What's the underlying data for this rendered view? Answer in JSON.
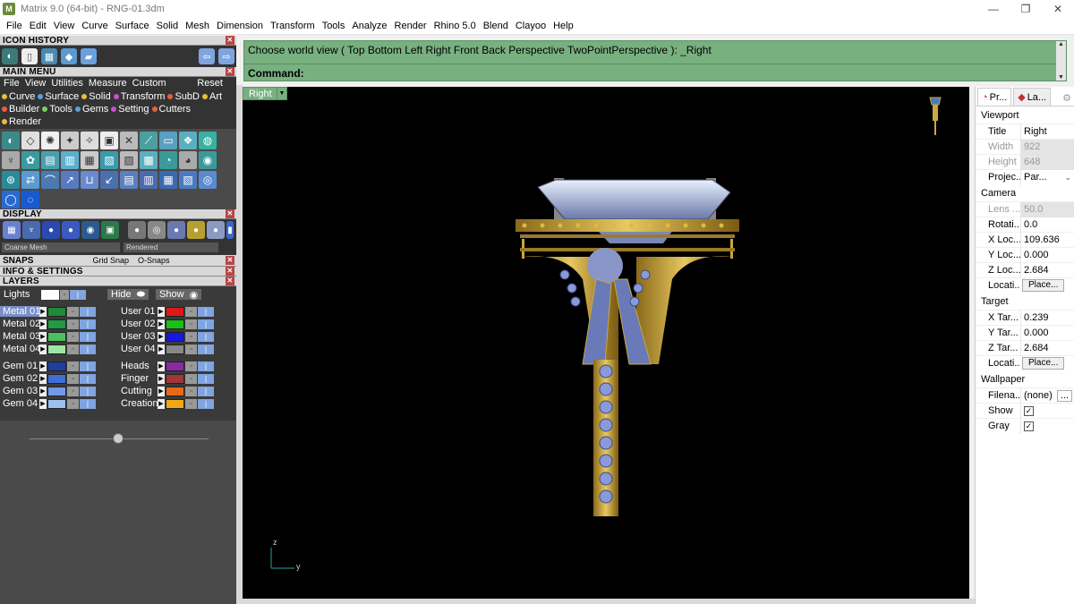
{
  "window": {
    "title": "Matrix 9.0 (64-bit) - RNG-01.3dm",
    "min": "—",
    "max": "❐",
    "close": "✕"
  },
  "menubar": [
    "File",
    "Edit",
    "View",
    "Curve",
    "Surface",
    "Solid",
    "Mesh",
    "Dimension",
    "Transform",
    "Tools",
    "Analyze",
    "Render",
    "Rhino 5.0",
    "Blend",
    "Clayoo",
    "Help"
  ],
  "panels": {
    "icon_history": "ICON HISTORY",
    "main_menu": "MAIN MENU",
    "display": "DISPLAY",
    "snaps": "SNAPS",
    "info": "INFO & SETTINGS",
    "layers": "LAYERS",
    "close": "✕"
  },
  "main_menu": {
    "items": [
      "File",
      "View",
      "Utilities",
      "Measure",
      "Custom"
    ],
    "reset": "Reset",
    "categories": [
      {
        "label": "Curve",
        "color": "#e8c038"
      },
      {
        "label": "Surface",
        "color": "#5aa0e0"
      },
      {
        "label": "Solid",
        "color": "#e8c038"
      },
      {
        "label": "Transform",
        "color": "#c84fd0"
      },
      {
        "label": "SubD",
        "color": "#e86040"
      },
      {
        "label": "Art",
        "color": "#e8c038"
      },
      {
        "label": "Builder",
        "color": "#e86040"
      },
      {
        "label": "Tools",
        "color": "#7ad060"
      },
      {
        "label": "Gems",
        "color": "#5aa0e0"
      },
      {
        "label": "Setting",
        "color": "#c84fd0"
      },
      {
        "label": "Cutters",
        "color": "#e86040"
      },
      {
        "label": "Render",
        "color": "#e8c038"
      }
    ]
  },
  "display": {
    "mesh": "Coarse Mesh",
    "mode": "Rendered"
  },
  "snaps": {
    "grid_snap": "Grid Snap",
    "osnaps": "O-Snaps"
  },
  "layers": {
    "lights": "Lights",
    "hide": "Hide",
    "show": "Show",
    "left": [
      {
        "name": "Metal 01",
        "color": "#1f8a3a",
        "selected": true
      },
      {
        "name": "Metal 02",
        "color": "#1f9a46"
      },
      {
        "name": "Metal 03",
        "color": "#4cc060"
      },
      {
        "name": "Metal 04",
        "color": "#9ee6a6"
      },
      {
        "name": "Gem 01",
        "color": "#1e3fa0",
        "gap": true
      },
      {
        "name": "Gem 02",
        "color": "#3f6ed8"
      },
      {
        "name": "Gem 03",
        "color": "#6f9ae8"
      },
      {
        "name": "Gem 04",
        "color": "#9cc0f0"
      }
    ],
    "right": [
      {
        "name": "User 01",
        "color": "#e01818"
      },
      {
        "name": "User 02",
        "color": "#18c018"
      },
      {
        "name": "User 03",
        "color": "#1818e0"
      },
      {
        "name": "User 04",
        "color": "#888888"
      },
      {
        "name": "Heads",
        "color": "#8a2aa0",
        "gap": true
      },
      {
        "name": "Finger",
        "color": "#a03838"
      },
      {
        "name": "Cutting",
        "color": "#e86a18"
      },
      {
        "name": "Creation",
        "color": "#f0a818"
      }
    ]
  },
  "command": {
    "prompt": "Choose world view ( Top  Bottom  Left  Right  Front  Back  Perspective  TwoPointPerspective ): _Right",
    "label": "Command:"
  },
  "viewport": {
    "name": "Right",
    "axis_z": "z",
    "axis_y": "y"
  },
  "properties": {
    "tab1": "Pr...",
    "tab2": "La...",
    "viewport_section": "Viewport",
    "title_label": "Title",
    "title_value": "Right",
    "width_label": "Width",
    "width_value": "922",
    "height_label": "Height",
    "height_value": "648",
    "projection_label": "Projec...",
    "projection_value": "Par...",
    "camera_section": "Camera",
    "lens_label": "Lens ...",
    "lens_value": "50.0",
    "rotation_label": "Rotati...",
    "rotation_value": "0.0",
    "xloc_label": "X Loc...",
    "xloc_value": "109.636",
    "yloc_label": "Y Loc...",
    "yloc_value": "0.000",
    "zloc_label": "Z Loc...",
    "zloc_value": "2.684",
    "location_label": "Locati...",
    "place_button": "Place...",
    "target_section": "Target",
    "xtar_label": "X Tar...",
    "xtar_value": "0.239",
    "ytar_label": "Y Tar...",
    "ytar_value": "0.000",
    "ztar_label": "Z Tar...",
    "ztar_value": "2.684",
    "tlocation_label": "Locati...",
    "tplace_button": "Place...",
    "wallpaper_section": "Wallpaper",
    "filename_label": "Filena...",
    "filename_value": "(none)",
    "browse": "...",
    "show_label": "Show",
    "gray_label": "Gray"
  }
}
